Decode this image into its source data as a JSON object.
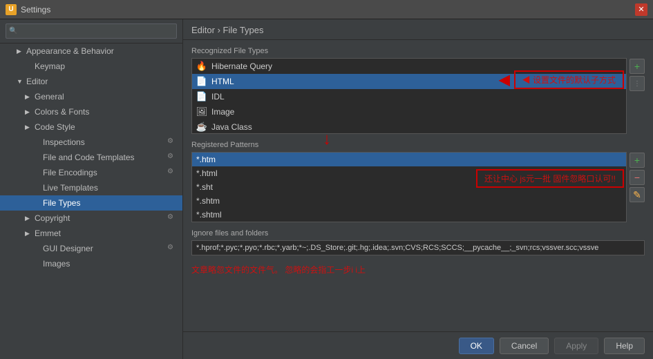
{
  "titleBar": {
    "icon": "U",
    "title": "Settings",
    "closeIcon": "✕"
  },
  "search": {
    "placeholder": ""
  },
  "sidebar": {
    "items": [
      {
        "id": "appearance",
        "label": "Appearance & Behavior",
        "level": 0,
        "arrow": "▶",
        "bold": true,
        "selected": false
      },
      {
        "id": "keymap",
        "label": "Keymap",
        "level": 1,
        "arrow": "",
        "bold": false,
        "selected": false
      },
      {
        "id": "editor",
        "label": "Editor",
        "level": 0,
        "arrow": "▼",
        "bold": true,
        "selected": false
      },
      {
        "id": "general",
        "label": "General",
        "level": 1,
        "arrow": "▶",
        "bold": false,
        "selected": false
      },
      {
        "id": "colors-fonts",
        "label": "Colors & Fonts",
        "level": 1,
        "arrow": "▶",
        "bold": false,
        "selected": false
      },
      {
        "id": "code-style",
        "label": "Code Style",
        "level": 1,
        "arrow": "▶",
        "bold": false,
        "selected": false
      },
      {
        "id": "inspections",
        "label": "Inspections",
        "level": 2,
        "arrow": "",
        "badge": true,
        "selected": false
      },
      {
        "id": "file-code-templates",
        "label": "File and Code Templates",
        "level": 2,
        "arrow": "",
        "badge": true,
        "selected": false
      },
      {
        "id": "file-encodings",
        "label": "File Encodings",
        "level": 2,
        "arrow": "",
        "badge": true,
        "selected": false
      },
      {
        "id": "live-templates",
        "label": "Live Templates",
        "level": 2,
        "arrow": "",
        "badge": false,
        "selected": false
      },
      {
        "id": "file-types",
        "label": "File Types",
        "level": 2,
        "arrow": "",
        "badge": false,
        "selected": true
      },
      {
        "id": "copyright",
        "label": "Copyright",
        "level": 1,
        "arrow": "▶",
        "bold": false,
        "selected": false,
        "badge": true
      },
      {
        "id": "emmet",
        "label": "Emmet",
        "level": 1,
        "arrow": "▶",
        "bold": false,
        "selected": false
      },
      {
        "id": "gui-designer",
        "label": "GUI Designer",
        "level": 2,
        "arrow": "",
        "badge": true,
        "selected": false
      },
      {
        "id": "images",
        "label": "Images",
        "level": 2,
        "arrow": "",
        "badge": false,
        "selected": false
      }
    ]
  },
  "content": {
    "breadcrumb": "Editor › File Types",
    "recognizedSection": "Recognized File Types",
    "fileTypes": [
      {
        "icon": "🔥",
        "label": "Hibernate Query"
      },
      {
        "icon": "📄",
        "label": "HTML",
        "selected": true
      },
      {
        "icon": "📄",
        "label": "IDL"
      },
      {
        "icon": "🖼",
        "label": "Image"
      },
      {
        "icon": "☕",
        "label": "Java Class"
      }
    ],
    "annotationText": "◀ 设置文件的默认子方式",
    "registeredSection": "Registered Patterns",
    "patterns": [
      {
        "label": "*.htm",
        "selected": true
      },
      {
        "label": "*.html"
      },
      {
        "label": "*.sht"
      },
      {
        "label": "*.shtm"
      },
      {
        "label": "*.shtml"
      }
    ],
    "patternsAnnotation": "还让中心  js元一批 固件忽略口认可!!",
    "ignoreSection": "Ignore files and folders",
    "ignoreValue": "*.hprof;*.pyc;*.pyo;*.rbc;*.yarb;*~;.DS_Store;.git;.hg;.idea;.svn;CVS;RCS;SCCS;__pycache__;_svn;rcs;vssver.scc;vssve",
    "bottomAnnotation": "文章略忽文件的文件气。 忽略的会指工一步i  i上",
    "buttons": {
      "ok": "OK",
      "cancel": "Cancel",
      "apply": "Apply",
      "help": "Help"
    }
  }
}
